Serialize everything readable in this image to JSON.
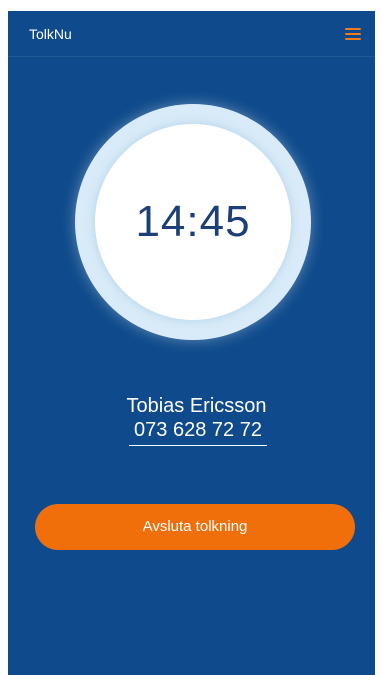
{
  "header": {
    "app_title": "TolkNu",
    "menu_icon": "hamburger-menu-icon"
  },
  "timer": {
    "value": "14:45"
  },
  "caller": {
    "name": "Tobias Ericsson",
    "phone": "073 628 72 72"
  },
  "actions": {
    "end_label": "Avsluta tolkning"
  },
  "colors": {
    "background": "#0f4b8c",
    "accent": "#f16f0b",
    "timer_text": "#1c3f78",
    "ring": "#d9ebf8"
  }
}
